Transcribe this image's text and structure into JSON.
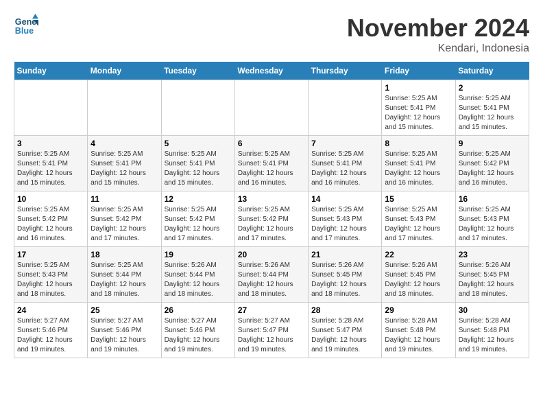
{
  "header": {
    "logo_line1": "General",
    "logo_line2": "Blue",
    "month_title": "November 2024",
    "location": "Kendari, Indonesia"
  },
  "weekdays": [
    "Sunday",
    "Monday",
    "Tuesday",
    "Wednesday",
    "Thursday",
    "Friday",
    "Saturday"
  ],
  "weeks": [
    [
      {
        "day": "",
        "info": ""
      },
      {
        "day": "",
        "info": ""
      },
      {
        "day": "",
        "info": ""
      },
      {
        "day": "",
        "info": ""
      },
      {
        "day": "",
        "info": ""
      },
      {
        "day": "1",
        "info": "Sunrise: 5:25 AM\nSunset: 5:41 PM\nDaylight: 12 hours\nand 15 minutes."
      },
      {
        "day": "2",
        "info": "Sunrise: 5:25 AM\nSunset: 5:41 PM\nDaylight: 12 hours\nand 15 minutes."
      }
    ],
    [
      {
        "day": "3",
        "info": "Sunrise: 5:25 AM\nSunset: 5:41 PM\nDaylight: 12 hours\nand 15 minutes."
      },
      {
        "day": "4",
        "info": "Sunrise: 5:25 AM\nSunset: 5:41 PM\nDaylight: 12 hours\nand 15 minutes."
      },
      {
        "day": "5",
        "info": "Sunrise: 5:25 AM\nSunset: 5:41 PM\nDaylight: 12 hours\nand 15 minutes."
      },
      {
        "day": "6",
        "info": "Sunrise: 5:25 AM\nSunset: 5:41 PM\nDaylight: 12 hours\nand 16 minutes."
      },
      {
        "day": "7",
        "info": "Sunrise: 5:25 AM\nSunset: 5:41 PM\nDaylight: 12 hours\nand 16 minutes."
      },
      {
        "day": "8",
        "info": "Sunrise: 5:25 AM\nSunset: 5:41 PM\nDaylight: 12 hours\nand 16 minutes."
      },
      {
        "day": "9",
        "info": "Sunrise: 5:25 AM\nSunset: 5:42 PM\nDaylight: 12 hours\nand 16 minutes."
      }
    ],
    [
      {
        "day": "10",
        "info": "Sunrise: 5:25 AM\nSunset: 5:42 PM\nDaylight: 12 hours\nand 16 minutes."
      },
      {
        "day": "11",
        "info": "Sunrise: 5:25 AM\nSunset: 5:42 PM\nDaylight: 12 hours\nand 17 minutes."
      },
      {
        "day": "12",
        "info": "Sunrise: 5:25 AM\nSunset: 5:42 PM\nDaylight: 12 hours\nand 17 minutes."
      },
      {
        "day": "13",
        "info": "Sunrise: 5:25 AM\nSunset: 5:42 PM\nDaylight: 12 hours\nand 17 minutes."
      },
      {
        "day": "14",
        "info": "Sunrise: 5:25 AM\nSunset: 5:43 PM\nDaylight: 12 hours\nand 17 minutes."
      },
      {
        "day": "15",
        "info": "Sunrise: 5:25 AM\nSunset: 5:43 PM\nDaylight: 12 hours\nand 17 minutes."
      },
      {
        "day": "16",
        "info": "Sunrise: 5:25 AM\nSunset: 5:43 PM\nDaylight: 12 hours\nand 17 minutes."
      }
    ],
    [
      {
        "day": "17",
        "info": "Sunrise: 5:25 AM\nSunset: 5:43 PM\nDaylight: 12 hours\nand 18 minutes."
      },
      {
        "day": "18",
        "info": "Sunrise: 5:25 AM\nSunset: 5:44 PM\nDaylight: 12 hours\nand 18 minutes."
      },
      {
        "day": "19",
        "info": "Sunrise: 5:26 AM\nSunset: 5:44 PM\nDaylight: 12 hours\nand 18 minutes."
      },
      {
        "day": "20",
        "info": "Sunrise: 5:26 AM\nSunset: 5:44 PM\nDaylight: 12 hours\nand 18 minutes."
      },
      {
        "day": "21",
        "info": "Sunrise: 5:26 AM\nSunset: 5:45 PM\nDaylight: 12 hours\nand 18 minutes."
      },
      {
        "day": "22",
        "info": "Sunrise: 5:26 AM\nSunset: 5:45 PM\nDaylight: 12 hours\nand 18 minutes."
      },
      {
        "day": "23",
        "info": "Sunrise: 5:26 AM\nSunset: 5:45 PM\nDaylight: 12 hours\nand 18 minutes."
      }
    ],
    [
      {
        "day": "24",
        "info": "Sunrise: 5:27 AM\nSunset: 5:46 PM\nDaylight: 12 hours\nand 19 minutes."
      },
      {
        "day": "25",
        "info": "Sunrise: 5:27 AM\nSunset: 5:46 PM\nDaylight: 12 hours\nand 19 minutes."
      },
      {
        "day": "26",
        "info": "Sunrise: 5:27 AM\nSunset: 5:46 PM\nDaylight: 12 hours\nand 19 minutes."
      },
      {
        "day": "27",
        "info": "Sunrise: 5:27 AM\nSunset: 5:47 PM\nDaylight: 12 hours\nand 19 minutes."
      },
      {
        "day": "28",
        "info": "Sunrise: 5:28 AM\nSunset: 5:47 PM\nDaylight: 12 hours\nand 19 minutes."
      },
      {
        "day": "29",
        "info": "Sunrise: 5:28 AM\nSunset: 5:48 PM\nDaylight: 12 hours\nand 19 minutes."
      },
      {
        "day": "30",
        "info": "Sunrise: 5:28 AM\nSunset: 5:48 PM\nDaylight: 12 hours\nand 19 minutes."
      }
    ]
  ]
}
